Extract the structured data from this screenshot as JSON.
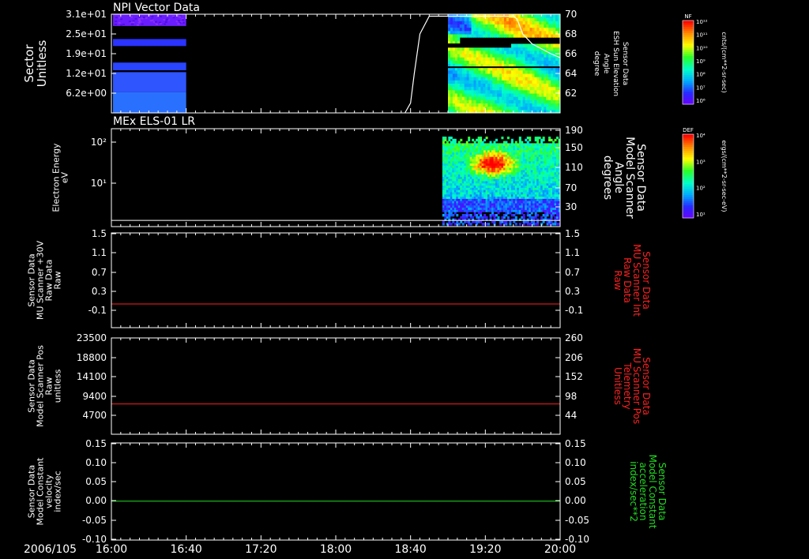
{
  "colors": {
    "background": "#000000",
    "frame": "#ffffff",
    "red_line": "#ff2020",
    "green_line": "#22dd22",
    "white_line": "#ffffff"
  },
  "chart_data": [
    {
      "type": "heatmap",
      "title": "NPI Vector Data",
      "ylabel": [
        "Sector",
        "Unitless"
      ],
      "ytick_labels": [
        "3.1e+01",
        "2.5e+01",
        "1.9e+01",
        "1.2e+01",
        "6.2e+00"
      ],
      "ylim": [
        0,
        31
      ],
      "right_ylabel": [
        "Sensor Data",
        "ESH Sun Elevation",
        "Angle",
        "degree"
      ],
      "right_ticks": [
        "70",
        "68",
        "66",
        "64",
        "62"
      ],
      "right_ylim": [
        60,
        70
      ],
      "colorbar": {
        "title": "NF",
        "unit": "cnts/(cm**2-sr-sec)",
        "tick_labels": [
          "10¹²",
          "10¹¹",
          "10¹⁰",
          "10⁹",
          "10⁸",
          "10⁷",
          "10⁶"
        ]
      },
      "overlay_line": {
        "t": [
          "18:37",
          "18:40",
          "18:42",
          "18:45",
          "18:50",
          "19:00",
          "19:10",
          "19:15",
          "19:18",
          "19:20",
          "19:30",
          "19:35",
          "19:37",
          "19:40",
          "19:45",
          "19:50",
          "19:55",
          "20:00"
        ],
        "y": [
          60,
          61,
          64,
          68,
          69.8,
          69.8,
          69.8,
          69.8,
          69.8,
          69.8,
          69.8,
          69.8,
          69.5,
          68,
          67,
          66.5,
          66,
          65.6
        ]
      }
    },
    {
      "type": "heatmap",
      "title": "MEx ELS-01 LR",
      "ylabel": [
        "Electron Energy",
        "eV"
      ],
      "ytick_labels": [
        "10²",
        "10¹"
      ],
      "scale": "log",
      "right_ylabel": [
        "Sensor Data",
        "Model Scanner",
        "Angle",
        "degrees"
      ],
      "right_ticks": [
        "190",
        "150",
        "110",
        "70",
        "30"
      ],
      "right_ylim": [
        0,
        190
      ],
      "colorbar": {
        "title": "DEF",
        "unit": "ergs/(cm**2-sr-sec-eV)",
        "tick_labels": [
          "10⁴",
          "10³",
          "10²",
          "10¹"
        ]
      },
      "overlay_line": {
        "t": [
          "16:00",
          "20:00"
        ],
        "y": [
          12,
          12
        ]
      }
    },
    {
      "type": "line",
      "ylabel": [
        "Sensor Data",
        "MU Scanner +30V",
        "Raw Data",
        "Raw"
      ],
      "ytick_labels": [
        "1.5",
        "1.1",
        "0.7",
        "0.3",
        "-0.1"
      ],
      "ylim": [
        -0.5,
        1.5
      ],
      "right_ylabel": [
        "Sensor Data",
        "MU Scanner Int",
        "Raw Data",
        "Raw"
      ],
      "right_ticks": [
        "1.5",
        "1.1",
        "0.7",
        "0.3",
        "-0.1"
      ],
      "series": [
        {
          "values": [
            0,
            0
          ],
          "color": "#ff2020"
        }
      ]
    },
    {
      "type": "line",
      "ylabel": [
        "Sensor Data",
        "Model Scanner Pos",
        "Raw",
        "unitless"
      ],
      "ytick_labels": [
        "23500",
        "18800",
        "14100",
        "9400",
        "4700"
      ],
      "ylim": [
        0,
        23500
      ],
      "right_ylabel": [
        "Sensor Data",
        "MU Scanner Pos",
        "Telemetry",
        "Unitless"
      ],
      "right_ticks": [
        "260",
        "206",
        "152",
        "98",
        "44"
      ],
      "series": [
        {
          "values": [
            7400,
            7400
          ],
          "color": "#ff2020"
        }
      ]
    },
    {
      "type": "line",
      "ylabel": [
        "Sensor Data",
        "Model Constant",
        "velocity",
        "index/sec"
      ],
      "ytick_labels": [
        "0.15",
        "0.10",
        "0.05",
        "0.00",
        "-0.05",
        "-0.10"
      ],
      "ylim": [
        -0.1,
        0.15
      ],
      "right_ylabel": [
        "Sensor Data",
        "Model Constant",
        "acceleration",
        "index/sec**2"
      ],
      "right_ticks": [
        "0.15",
        "0.10",
        "0.05",
        "0.00",
        "-0.05",
        "-0.10"
      ],
      "series": [
        {
          "values": [
            0,
            0
          ],
          "color": "#22dd22"
        }
      ]
    }
  ],
  "x_axis": {
    "date_label": "2006/105",
    "tick_labels": [
      "16:00",
      "16:40",
      "17:20",
      "18:00",
      "18:40",
      "19:20",
      "20:00"
    ]
  }
}
